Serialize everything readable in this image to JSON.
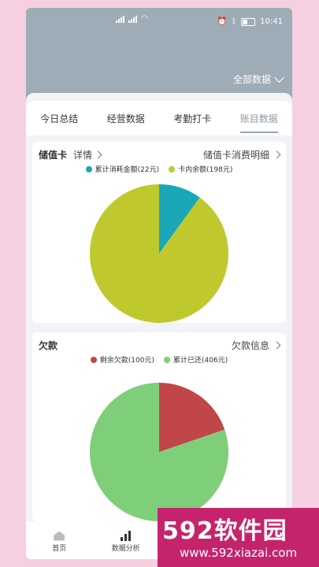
{
  "status": {
    "time": "10:41"
  },
  "header": {
    "filter_label": "全部数据"
  },
  "tabs": [
    {
      "label": "今日总结"
    },
    {
      "label": "经营数据"
    },
    {
      "label": "考勤打卡"
    },
    {
      "label": "账目数据"
    }
  ],
  "card1": {
    "title": "储值卡",
    "detail_label": "详情",
    "right_link": "储值卡消费明细",
    "legend": [
      {
        "label": "累计消耗金额(22元)",
        "color": "#1aa7b6"
      },
      {
        "label": "卡内余额(198元)",
        "color": "#bfc92e"
      }
    ]
  },
  "card2": {
    "title": "欠款",
    "right_link": "欠款信息",
    "legend": [
      {
        "label": "剩余欠款(100元)",
        "color": "#c1464a"
      },
      {
        "label": "累计已还(406元)",
        "color": "#7fce7a"
      }
    ]
  },
  "chart_data": [
    {
      "type": "pie",
      "categories": [
        "累计消耗金额",
        "卡内余额"
      ],
      "values": [
        22,
        198
      ],
      "colors": [
        "#1aa7b6",
        "#bfc92e"
      ]
    },
    {
      "type": "pie",
      "categories": [
        "剩余欠款",
        "累计已还"
      ],
      "values": [
        100,
        406
      ],
      "colors": [
        "#c1464a",
        "#7fce7a"
      ]
    }
  ],
  "bottom_nav": [
    {
      "label": "首页"
    },
    {
      "label": "数据分析"
    }
  ],
  "watermark": {
    "logo": "592软件园",
    "url": "www.592xiazai.com"
  }
}
